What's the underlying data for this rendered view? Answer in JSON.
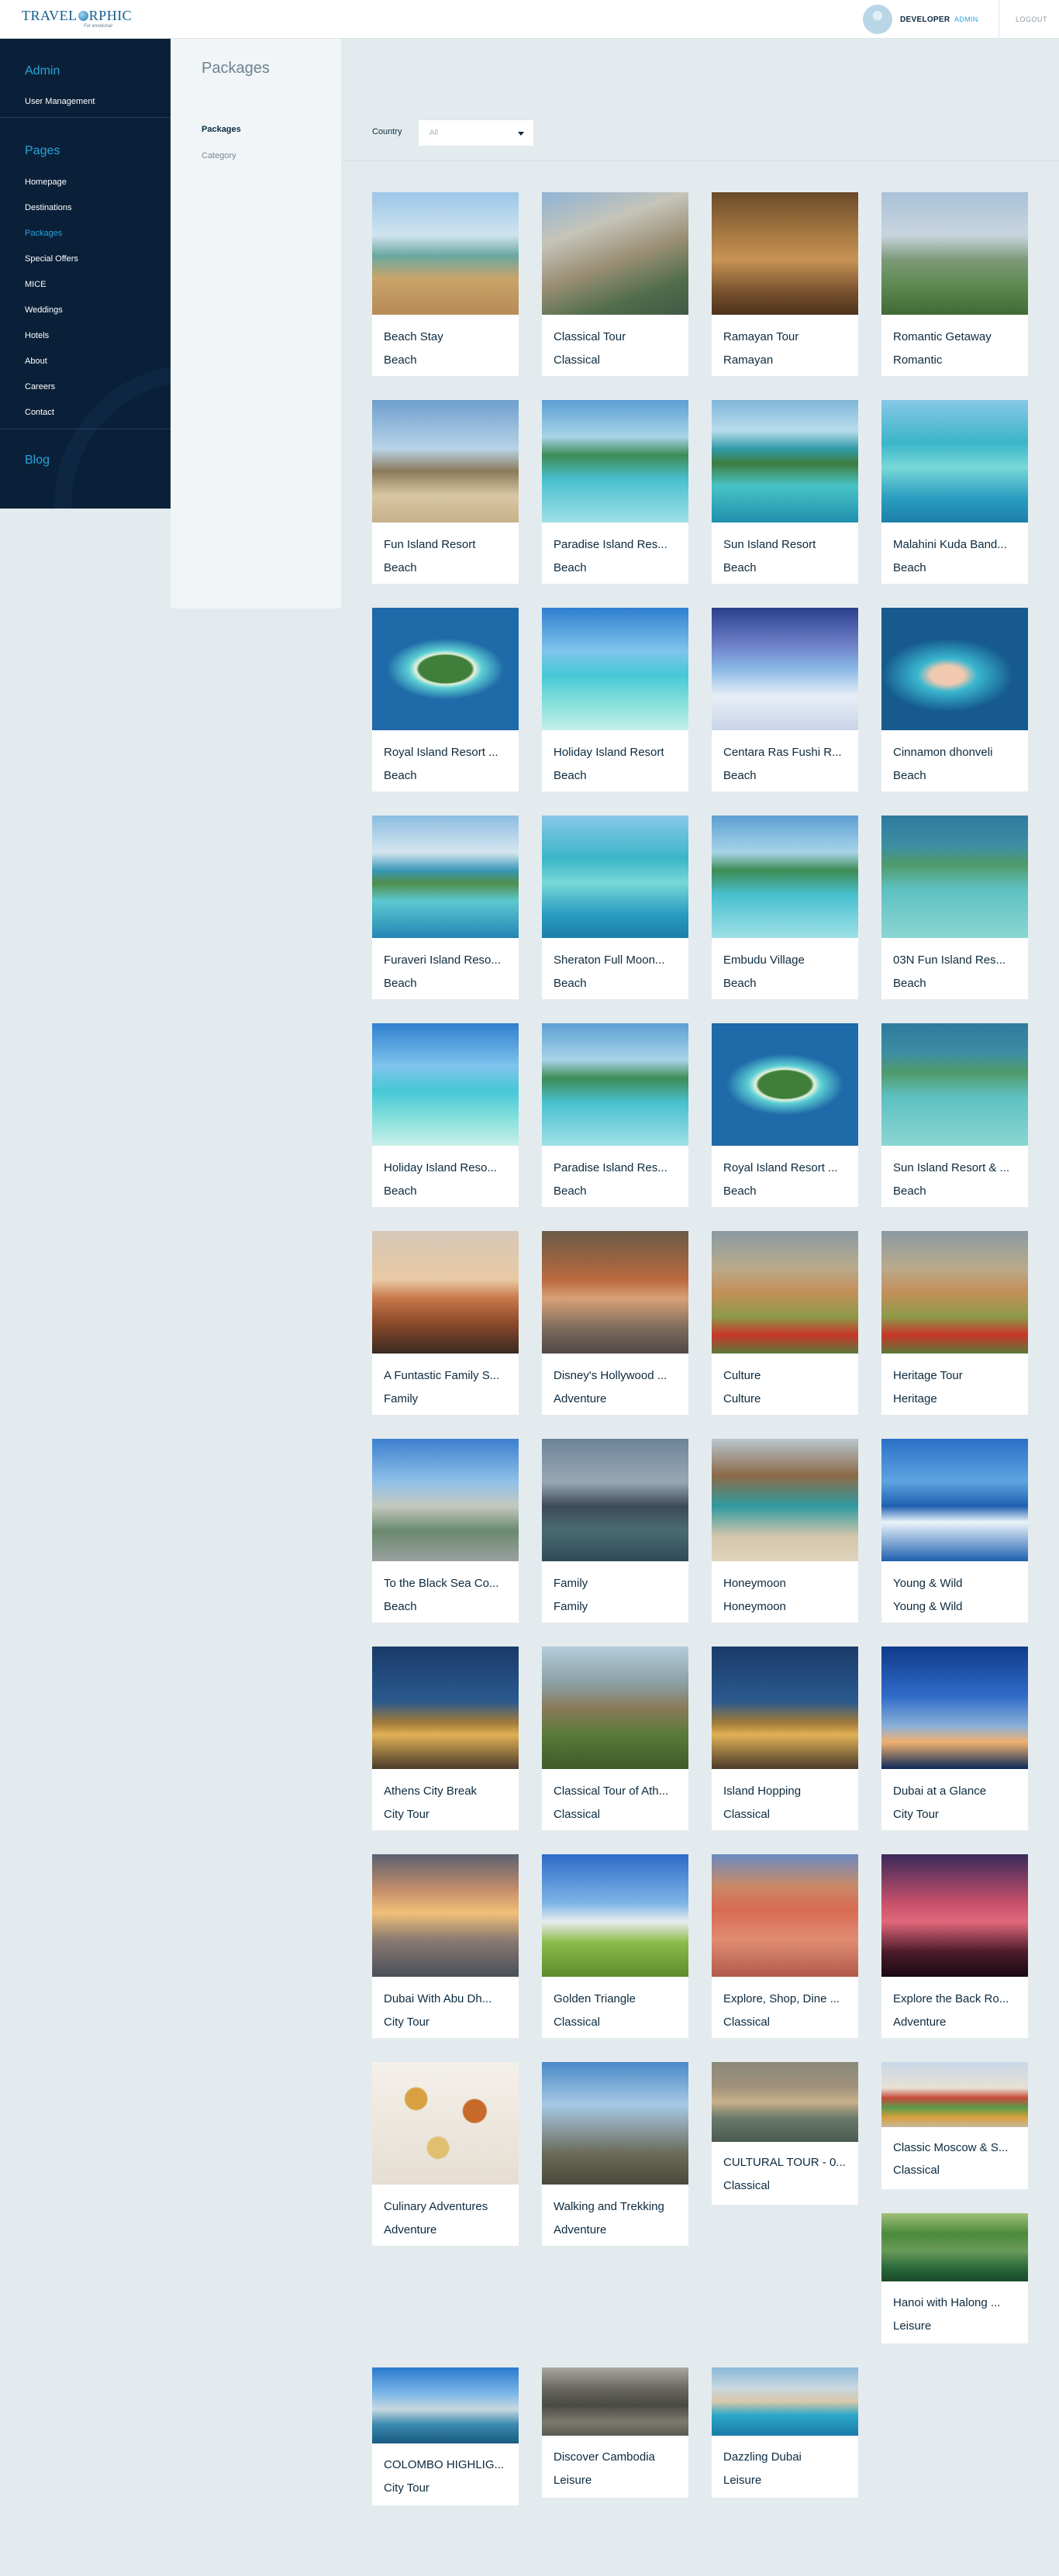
{
  "header": {
    "logo_main": "TRAVELORPHIC",
    "logo_prefix": "TRAVEL",
    "logo_suffix": "RPHIC",
    "logo_sub": "For emotional",
    "user_name": "DEVELOPER",
    "user_role": "ADMIN",
    "logout_label": "LOGOUT"
  },
  "sidebar": {
    "admin_heading": "Admin",
    "admin_items": [
      {
        "label": "User Management"
      }
    ],
    "pages_heading": "Pages",
    "page_items": [
      {
        "label": "Homepage"
      },
      {
        "label": "Destinations"
      },
      {
        "label": "Packages",
        "active": true
      },
      {
        "label": "Special Offers"
      },
      {
        "label": "MICE"
      },
      {
        "label": "Weddings"
      },
      {
        "label": "Hotels"
      },
      {
        "label": "About"
      },
      {
        "label": "Careers"
      },
      {
        "label": "Contact"
      }
    ],
    "blog_heading": "Blog"
  },
  "page_title": "Packages",
  "subnav": {
    "items": [
      {
        "label": "Packages",
        "active": true
      },
      {
        "label": "Category"
      }
    ]
  },
  "filter": {
    "label": "Country",
    "value": "All"
  },
  "packages": [
    {
      "title": "Beach Stay",
      "category": "Beach"
    },
    {
      "title": "Classical Tour",
      "category": "Classical"
    },
    {
      "title": "Ramayan Tour",
      "category": "Ramayan"
    },
    {
      "title": "Romantic Getaway",
      "category": "Romantic"
    },
    {
      "title": "Fun Island Resort",
      "category": "Beach"
    },
    {
      "title": "Paradise Island Res...",
      "category": "Beach"
    },
    {
      "title": "Sun Island Resort",
      "category": "Beach"
    },
    {
      "title": "Malahini Kuda Band...",
      "category": "Beach"
    },
    {
      "title": "Royal Island Resort ...",
      "category": "Beach"
    },
    {
      "title": "Holiday Island Resort",
      "category": "Beach"
    },
    {
      "title": "Centara Ras Fushi R...",
      "category": "Beach"
    },
    {
      "title": "Cinnamon dhonveli",
      "category": "Beach"
    },
    {
      "title": "Furaveri Island Reso...",
      "category": "Beach"
    },
    {
      "title": "Sheraton Full Moon...",
      "category": "Beach"
    },
    {
      "title": "Embudu Village",
      "category": "Beach"
    },
    {
      "title": "03N Fun Island Res...",
      "category": "Beach"
    },
    {
      "title": "Holiday Island Reso...",
      "category": "Beach"
    },
    {
      "title": "Paradise Island Res...",
      "category": "Beach"
    },
    {
      "title": "Royal Island Resort ...",
      "category": "Beach"
    },
    {
      "title": "Sun Island Resort & ...",
      "category": "Beach"
    },
    {
      "title": "A Funtastic Family S...",
      "category": "Family"
    },
    {
      "title": "Disney's Hollywood ...",
      "category": "Adventure"
    },
    {
      "title": "Culture",
      "category": "Culture"
    },
    {
      "title": "Heritage Tour",
      "category": "Heritage"
    },
    {
      "title": "To the Black Sea Co...",
      "category": "Beach"
    },
    {
      "title": "Family",
      "category": "Family"
    },
    {
      "title": "Honeymoon",
      "category": "Honeymoon"
    },
    {
      "title": "Young & Wild",
      "category": "Young & Wild"
    },
    {
      "title": "Athens City Break",
      "category": "City Tour"
    },
    {
      "title": "Classical Tour of Ath...",
      "category": "Classical"
    },
    {
      "title": "Island Hopping",
      "category": "Classical"
    },
    {
      "title": "Dubai at a Glance",
      "category": "City Tour"
    },
    {
      "title": "Dubai With Abu Dh...",
      "category": "City Tour"
    },
    {
      "title": "Golden Triangle",
      "category": "Classical"
    },
    {
      "title": "Explore, Shop, Dine ...",
      "category": "Classical"
    },
    {
      "title": "Explore the Back Ro...",
      "category": "Adventure"
    },
    {
      "title": "Culinary Adventures",
      "category": "Adventure"
    },
    {
      "title": "Walking and Trekking",
      "category": "Adventure"
    },
    {
      "title": "CULTURAL TOUR - 0...",
      "category": "Classical"
    },
    {
      "title": "Classic Moscow & S...",
      "category": "Classical"
    },
    {
      "title": "Hanoi with Halong ...",
      "category": "Leisure"
    },
    {
      "title": "COLOMBO HIGHLIG...",
      "category": "City Tour"
    },
    {
      "title": "Discover Cambodia",
      "category": "Leisure"
    },
    {
      "title": "Dazzling Dubai",
      "category": "Leisure"
    }
  ]
}
